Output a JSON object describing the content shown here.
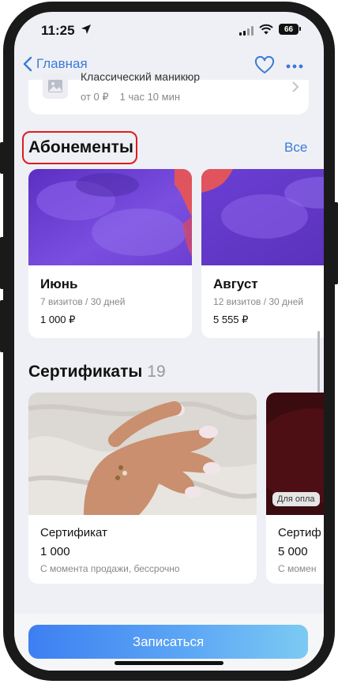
{
  "status_bar": {
    "time": "11:25",
    "battery": "66"
  },
  "nav": {
    "back_label": "Главная"
  },
  "service": {
    "title": "Классический маникюр",
    "price": "от 0 ₽",
    "duration": "1 час 10 мин"
  },
  "subscriptions": {
    "title": "Абонементы",
    "see_all": "Все",
    "items": [
      {
        "name": "Июнь",
        "visits": "7 визитов / 30 дней",
        "price": "1 000 ₽"
      },
      {
        "name": "Август",
        "visits": "12 визитов / 30 дней",
        "price": "5 555 ₽"
      }
    ]
  },
  "certificates": {
    "title": "Сертификаты",
    "count": "19",
    "items": [
      {
        "name": "Сертификат",
        "price": "1 000",
        "term": "С момента продажи, бессрочно"
      },
      {
        "name": "Сертиф",
        "price": "5 000",
        "term": "С момен",
        "tag": "Для опла"
      }
    ]
  },
  "cta": {
    "label": "Записаться"
  },
  "colors": {
    "accent": "#3a7bd5",
    "highlight": "#e01b1b"
  }
}
